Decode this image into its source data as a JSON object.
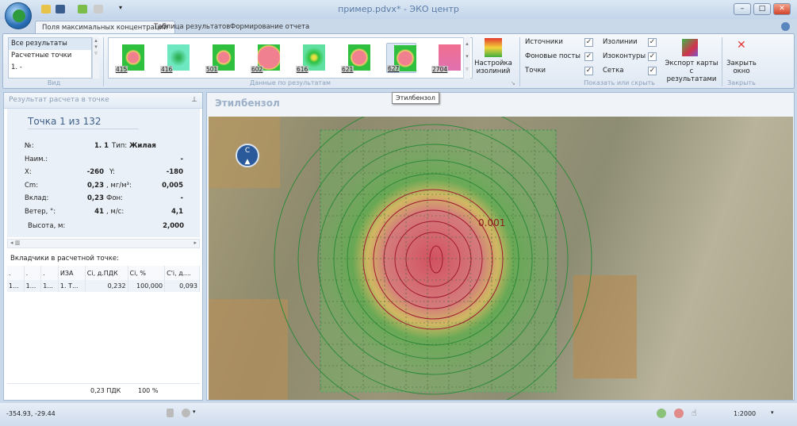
{
  "window": {
    "title": "пример.pdvx* - ЭКО центр",
    "minimize": "–",
    "maximize": "□",
    "close": "✕"
  },
  "tabs": [
    {
      "label": "Поля максимальных концентраций"
    },
    {
      "label": "Таблица результатов"
    },
    {
      "label": "Формирование отчета"
    }
  ],
  "ribbon": {
    "view": {
      "items": [
        "Все результаты",
        "Расчетные точки",
        "1. -"
      ],
      "group": "Вид"
    },
    "results": {
      "items": [
        "415",
        "416",
        "501",
        "602",
        "616",
        "621",
        "627",
        "2704"
      ],
      "group": "Данные по результатам",
      "selected": "627"
    },
    "isolines_btn": "Настройка изолиний",
    "show": {
      "group": "Показать или скрыть",
      "items": [
        {
          "label": "Источники",
          "checked": true
        },
        {
          "label": "Фоновые посты",
          "checked": true
        },
        {
          "label": "Точки",
          "checked": true
        },
        {
          "label": "Изолинии",
          "checked": true
        },
        {
          "label": "Изоконтуры",
          "checked": true
        },
        {
          "label": "Сетка",
          "checked": true
        }
      ]
    },
    "export_btn": "Экспорт карты с результатами",
    "close_btn": "Закрыть окно",
    "close_group": "Закрыть"
  },
  "tooltip": "Этилбензол",
  "left": {
    "title": "Результат расчета в точке",
    "point": "Точка 1 из 132",
    "fields": {
      "no_label": "№:",
      "no": "1. 1",
      "type_label": "Тип:",
      "type": "Жилая",
      "name_label": "Наим.:",
      "name": "-",
      "x_label": "X:",
      "x": "-260",
      "y_label": "Y:",
      "y": "-180",
      "cm_label": "Cm:",
      "cm": "0,23",
      "mg_label": ", мг/м³:",
      "mg": "0,005",
      "contrib_label": "Вклад:",
      "contrib": "0,23",
      "bg_label": "Фон:",
      "bg": "-",
      "wind_label": "Ветер, °:",
      "wind": "41",
      "ms_label": ", м/с:",
      "ms": "4,1",
      "height_label": "Высота, м:",
      "height": "2,000"
    },
    "contrib_title": "Вкладчики в расчетной точке:",
    "columns": [
      ".",
      ".",
      ".",
      "ИЗА",
      "Ci, д.ПДК",
      "Ci, %",
      "C'i, д...."
    ],
    "rows": [
      [
        "1...",
        "1...",
        "1...",
        "1. Т...",
        "0,232",
        "100,000",
        "0,093"
      ]
    ],
    "footer": [
      "0,23 ПДК",
      "100 %"
    ]
  },
  "map": {
    "title": "Этилбензол",
    "isoline_label": "0.001",
    "compass": "C"
  },
  "status": {
    "coords": "-354.93, -29.44",
    "scale": "1:2000"
  }
}
